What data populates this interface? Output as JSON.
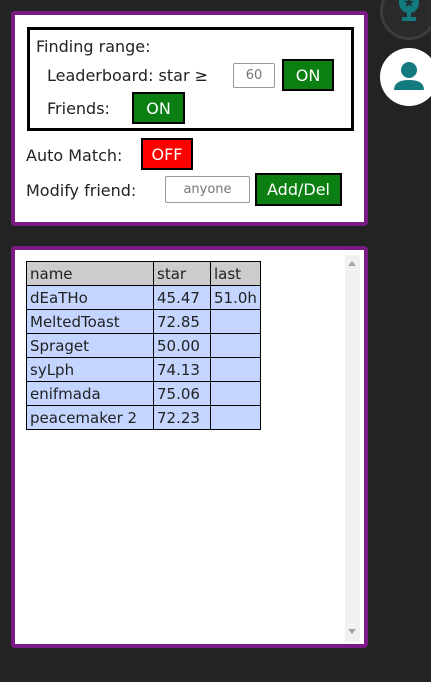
{
  "settings": {
    "finding_range_label": "Finding range:",
    "leaderboard_label": "Leaderboard: star ≥",
    "star_threshold_placeholder": "60",
    "leaderboard_toggle": "ON",
    "friends_label": "Friends:",
    "friends_toggle": "ON",
    "auto_match_label": "Auto Match:",
    "auto_match_toggle": "OFF",
    "modify_friend_label": "Modify friend:",
    "modify_friend_placeholder": "anyone",
    "add_del_label": "Add/Del"
  },
  "colors": {
    "panel_border": "#7a1a82",
    "toggle_on": "#0b7f12",
    "toggle_off": "#ff0000",
    "row_bg": "#c4d5ff",
    "header_bg": "#cccccc",
    "teal_icon": "#137a7f"
  },
  "table": {
    "headers": [
      "name",
      "star",
      "last"
    ],
    "rows": [
      [
        "dEaTHo",
        "45.47",
        "51.0h"
      ],
      [
        "MeltedToast",
        "72.85",
        ""
      ],
      [
        "Spraget",
        "50.00",
        ""
      ],
      [
        "syLph",
        "74.13",
        ""
      ],
      [
        "enifmada",
        "75.06",
        ""
      ],
      [
        "peacemaker 2",
        "72.23",
        ""
      ]
    ]
  },
  "side_icons": [
    "trophy-icon",
    "user-icon"
  ]
}
